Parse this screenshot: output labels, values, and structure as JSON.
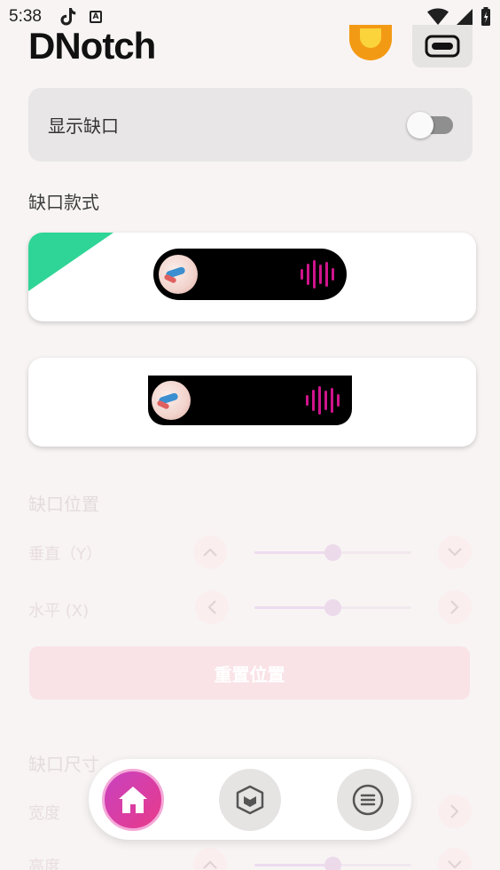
{
  "status_bar": {
    "time": "5:38",
    "notification_badge": "A"
  },
  "header": {
    "title": "DNotch"
  },
  "toggle_card": {
    "label": "显示缺口",
    "enabled": false
  },
  "style_section": {
    "title": "缺口款式"
  },
  "position_section": {
    "title": "缺口位置",
    "vertical_label": "垂直（Y）",
    "horizontal_label": "水平 (X)",
    "vertical_value": 0.5,
    "horizontal_value": 0.5
  },
  "reset_button": {
    "label": "重置位置"
  },
  "size_section": {
    "title": "缺口尺寸",
    "width_label": "宽度",
    "height_label": "高度",
    "height_value": 0.5
  },
  "bottom_nav": {
    "items": [
      {
        "icon": "home-icon",
        "active": true
      },
      {
        "icon": "cube-icon",
        "active": false
      },
      {
        "icon": "menu-icon",
        "active": false
      }
    ]
  },
  "colors": {
    "accent": "#d9409e",
    "flag": "#2fd596",
    "wave": "#d0148c"
  }
}
